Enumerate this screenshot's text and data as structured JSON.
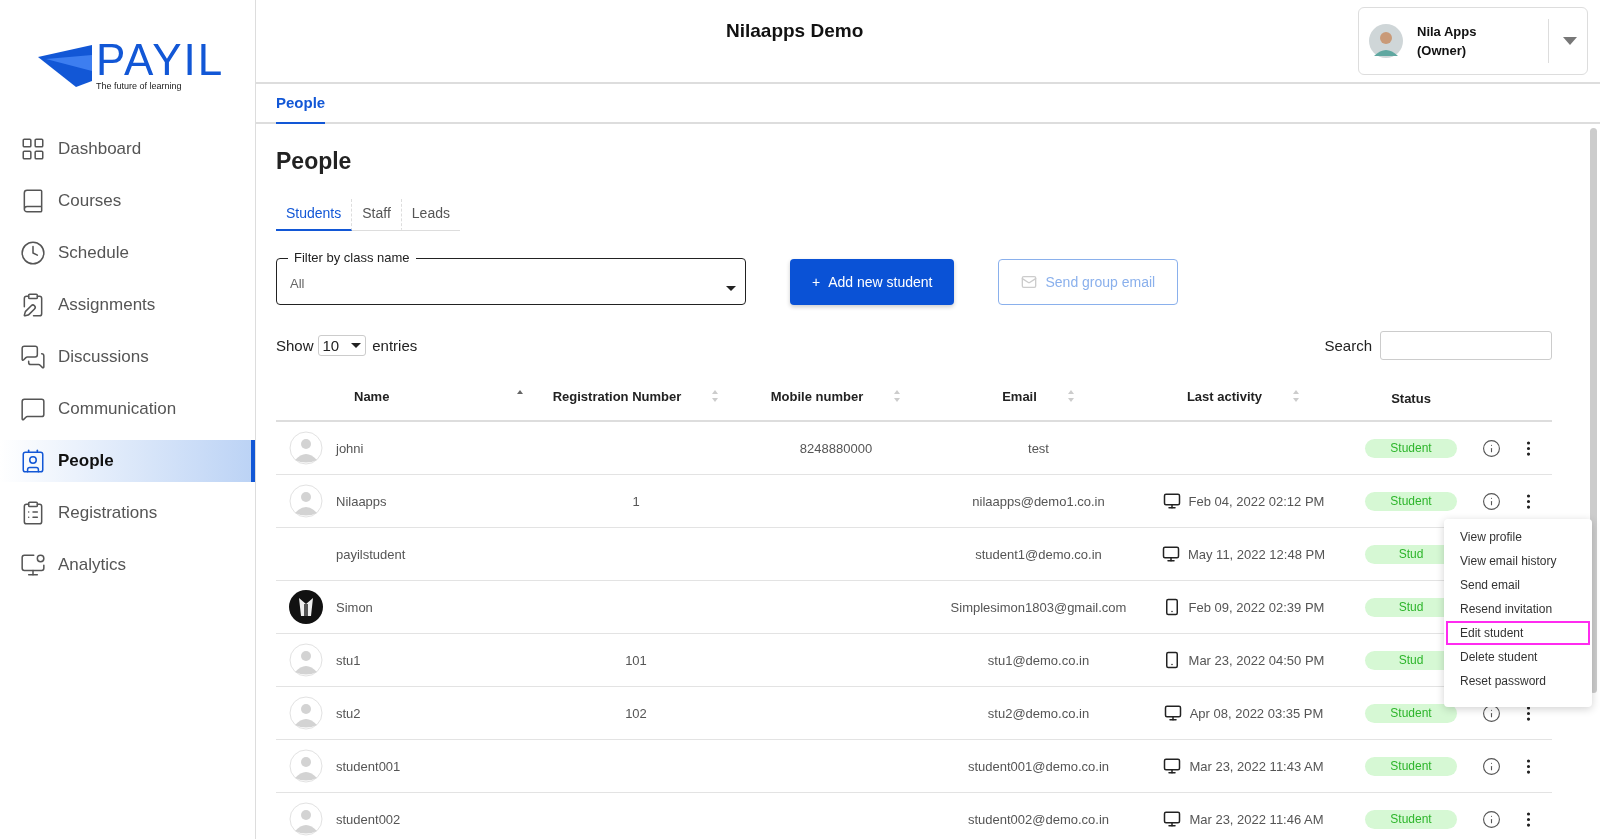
{
  "logo": {
    "name": "PAYIL",
    "tagline": "The future of learning"
  },
  "sidebar": {
    "items": [
      {
        "label": "Dashboard",
        "selected": false
      },
      {
        "label": "Courses",
        "selected": false
      },
      {
        "label": "Schedule",
        "selected": false
      },
      {
        "label": "Assignments",
        "selected": false
      },
      {
        "label": "Discussions",
        "selected": false
      },
      {
        "label": "Communication",
        "selected": false
      },
      {
        "label": "People",
        "selected": true
      },
      {
        "label": "Registrations",
        "selected": false
      },
      {
        "label": "Analytics",
        "selected": false
      }
    ]
  },
  "header": {
    "title": "Nilaapps Demo",
    "user": {
      "name": "Nila Apps",
      "role": "(Owner)"
    }
  },
  "nav_tabs": [
    {
      "label": "People",
      "selected": true
    }
  ],
  "page_title": "People",
  "tabs": [
    {
      "label": "Students",
      "selected": true
    },
    {
      "label": "Staff",
      "selected": false
    },
    {
      "label": "Leads",
      "selected": false
    }
  ],
  "filter": {
    "label": "Filter by class name",
    "value": "All"
  },
  "buttons": [
    {
      "kind": "primary",
      "icon": "+",
      "label": "Add new student",
      "disabled": false
    },
    {
      "kind": "outline",
      "label": "Send group email",
      "disabled": true
    }
  ],
  "entries": {
    "before": "Show",
    "value": "10",
    "after": "entries"
  },
  "search": {
    "label": "Search"
  },
  "table": {
    "columns": [
      {
        "label": "Name",
        "sortable": true,
        "sorted": true
      },
      {
        "label": "Registration Number",
        "sortable": true,
        "sorted": false
      },
      {
        "label": "Mobile number",
        "sortable": true,
        "sorted": false
      },
      {
        "label": "Email",
        "sortable": true,
        "sorted": false
      },
      {
        "label": "Last activity",
        "sortable": true,
        "sorted": false
      },
      {
        "label": "Status",
        "sortable": false
      }
    ],
    "rows": [
      {
        "has_avatar": true,
        "photo": false,
        "name": "johni",
        "mobile": "8248880000",
        "email": "test",
        "status": "Student",
        "menu_open": false
      },
      {
        "has_avatar": true,
        "photo": false,
        "name": "Nilaapps",
        "reg": "1",
        "email": "nilaapps@demo1.co.in",
        "on_mobile": false,
        "activity": "Feb 04, 2022 02:12 PM",
        "status": "Student",
        "menu_open": true
      },
      {
        "has_avatar": false,
        "name": "payilstudent",
        "email": "student1@demo.co.in",
        "on_mobile": false,
        "activity": "May 11, 2022 12:48 PM",
        "status": "Stud",
        "menu_open": false
      },
      {
        "has_avatar": true,
        "photo": true,
        "name": "Simon",
        "email": "Simplesimon1803@gmail.com",
        "on_mobile": true,
        "activity": "Feb 09, 2022 02:39 PM",
        "status": "Stud",
        "menu_open": false
      },
      {
        "has_avatar": true,
        "photo": false,
        "name": "stu1",
        "reg": "101",
        "email": "stu1@demo.co.in",
        "on_mobile": true,
        "activity": "Mar 23, 2022 04:50 PM",
        "status": "Stud",
        "menu_open": false
      },
      {
        "has_avatar": true,
        "photo": false,
        "name": "stu2",
        "reg": "102",
        "email": "stu2@demo.co.in",
        "on_mobile": false,
        "activity": "Apr 08, 2022 03:35 PM",
        "status": "Student",
        "menu_open": false
      },
      {
        "has_avatar": true,
        "photo": false,
        "name": "student001",
        "email": "student001@demo.co.in",
        "on_mobile": false,
        "activity": "Mar 23, 2022 11:43 AM",
        "status": "Student",
        "menu_open": false
      },
      {
        "has_avatar": true,
        "photo": false,
        "name": "student002",
        "email": "student002@demo.co.in",
        "on_mobile": false,
        "activity": "Mar 23, 2022 11:46 AM",
        "status": "Student",
        "menu_open": false
      }
    ]
  },
  "row_menu": [
    {
      "label": "View profile",
      "highlighted": false
    },
    {
      "label": "View email history",
      "highlighted": false
    },
    {
      "label": "Send email",
      "highlighted": false
    },
    {
      "label": "Resend invitation",
      "highlighted": false
    },
    {
      "label": "Edit student",
      "highlighted": true
    },
    {
      "label": "Delete student",
      "highlighted": false
    },
    {
      "label": "Reset password",
      "highlighted": false
    }
  ]
}
